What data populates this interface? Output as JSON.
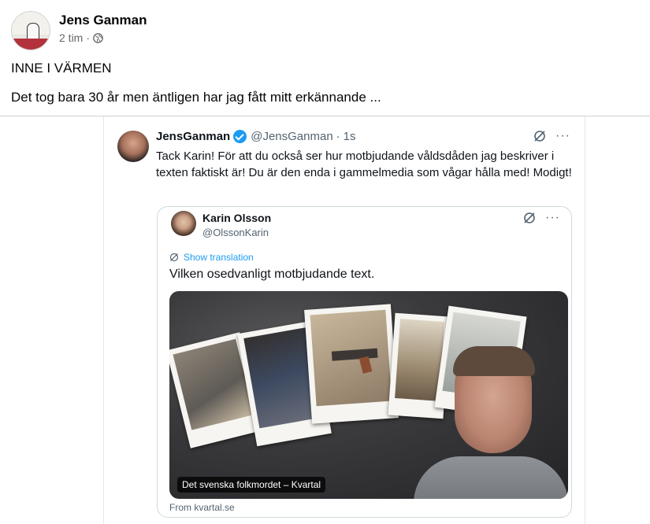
{
  "post": {
    "author_name": "Jens Ganman",
    "time": "2 tim",
    "separator": "·",
    "audience_icon": "globe-icon",
    "title": "INNE I VÄRMEN",
    "text": "Det tog bara 30 år men äntligen har jag fått mitt erkännande ..."
  },
  "tweet": {
    "name": "JensGanman",
    "verified_icon": "verified-check-icon",
    "handle": "@JensGanman",
    "separator": "·",
    "time": "1s",
    "more_label": "···",
    "body": "Tack Karin! För att du också ser hur motbjudande våldsdåden jag beskriver i texten faktiskt är! Du är den enda i gammelmedia som vågar hålla med! Modigt!",
    "quote": {
      "name": "Karin Olsson",
      "handle": "@OlssonKarin",
      "more_label": "···",
      "show_translation": "Show translation",
      "text": "Vilken osedvanligt motbjudande text.",
      "media_caption": "Det svenska folkmordet – Kvartal",
      "source": "From kvartal.se"
    }
  },
  "colors": {
    "facebook_meta": "#65676b",
    "x_blue": "#1d9bf0",
    "x_secondary": "#536471"
  }
}
